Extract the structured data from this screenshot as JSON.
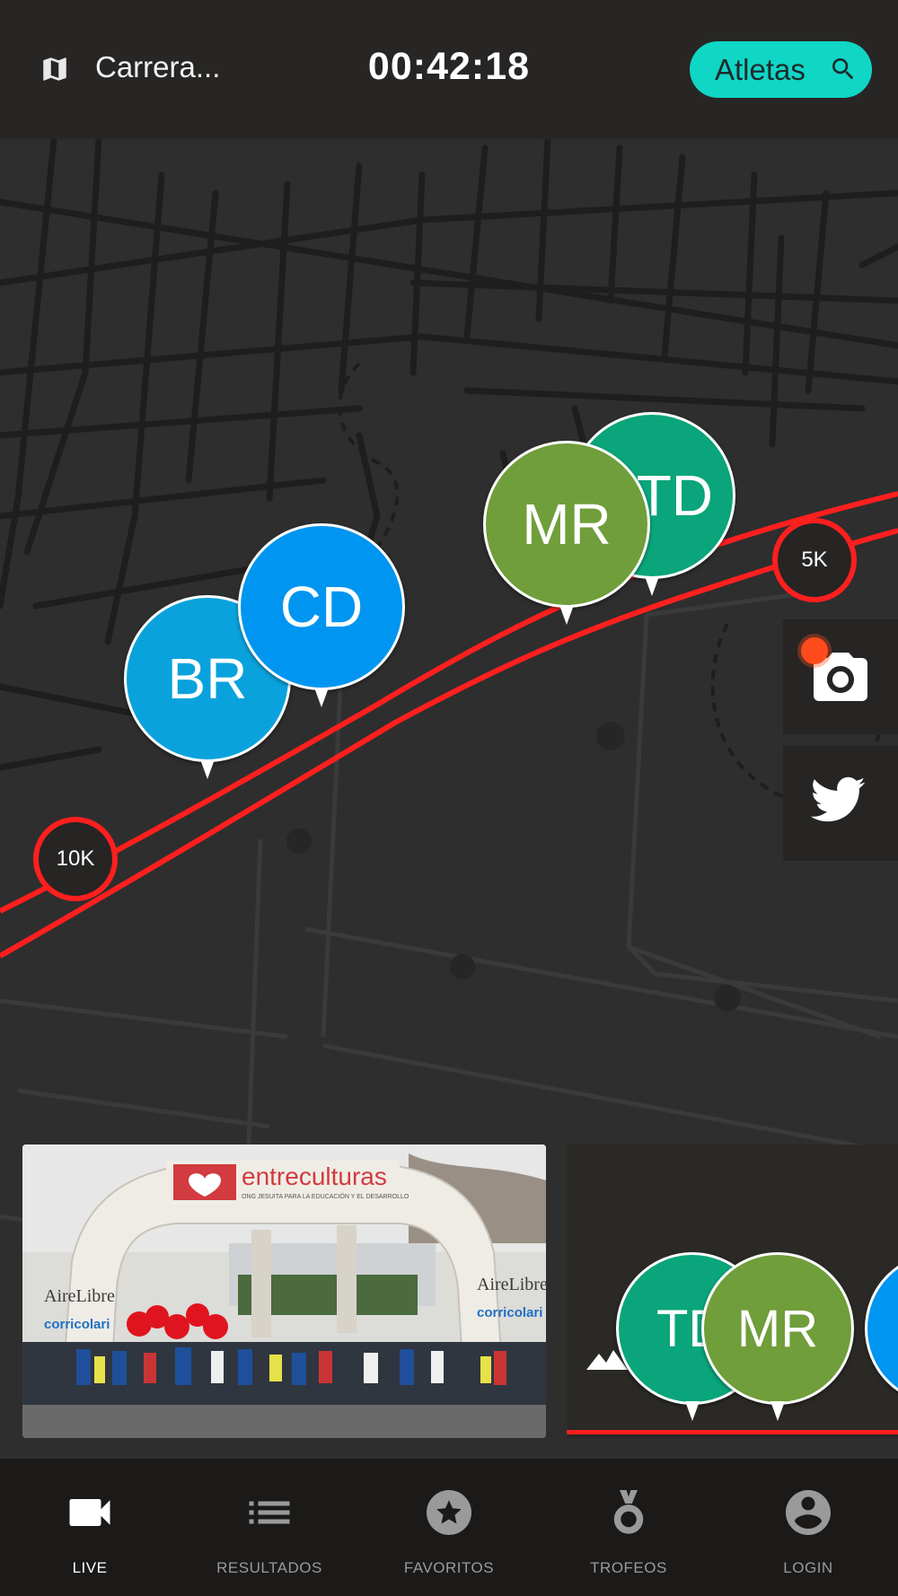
{
  "header": {
    "race_title": "Carrera...",
    "elapsed_time": "00:42:18",
    "athletes_button": "Atletas",
    "accent_color": "#10d6c6"
  },
  "map": {
    "route_color": "#ff1f1f",
    "markers": [
      {
        "initials": "BR",
        "color": "#0aa2dc"
      },
      {
        "initials": "CD",
        "color": "#0095f0"
      },
      {
        "initials": "TD",
        "color": "#0aa57a"
      },
      {
        "initials": "MR",
        "color": "#6f9e3a"
      }
    ],
    "km_markers": [
      "10K",
      "5K"
    ],
    "side_buttons": [
      "camera-icon",
      "twitter-icon"
    ]
  },
  "cards": {
    "photo": {
      "banner_text": "entreculturas",
      "banner_subtext": "ONG JESUITA PARA LA EDUCACIÓN Y EL DESARROLLO",
      "left_sponsor": "AireLibre",
      "left_sponsor_2": "corricolari",
      "right_sponsor": "AireLibre",
      "right_sponsor_2": "corricolari"
    },
    "map_preview": {
      "markers": [
        {
          "initials": "TD",
          "color": "#0aa57a"
        },
        {
          "initials": "MR",
          "color": "#6f9e3a"
        }
      ],
      "icon": "mountain-icon"
    }
  },
  "bottom_nav": [
    {
      "label": "LIVE",
      "icon": "video-camera-icon",
      "active": true
    },
    {
      "label": "RESULTADOS",
      "icon": "list-icon",
      "active": false
    },
    {
      "label": "FAVORITOS",
      "icon": "star-icon",
      "active": false
    },
    {
      "label": "TROFEOS",
      "icon": "medal-icon",
      "active": false
    },
    {
      "label": "LOGIN",
      "icon": "account-icon",
      "active": false
    }
  ]
}
